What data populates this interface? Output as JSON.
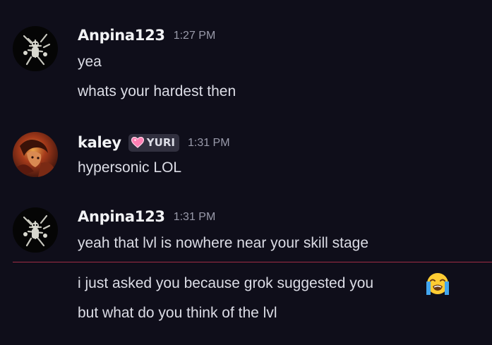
{
  "messages": [
    {
      "username": "Anpina123",
      "timestamp": "1:27 PM",
      "lines": [
        "yea",
        "whats your hardest then"
      ]
    },
    {
      "username": "kaley",
      "badge": "YURI",
      "timestamp": "1:31 PM",
      "lines": [
        "hypersonic LOL"
      ]
    },
    {
      "username": "Anpina123",
      "timestamp": "1:31 PM",
      "lines": [
        "yeah that lvl is nowhere near your skill stage"
      ]
    }
  ],
  "new_messages": [
    "i just asked you because grok suggested you",
    "but what do you think of the lvl"
  ],
  "icons": {
    "badge_icon": "pink-heart-icon",
    "emoji": "loudly-crying-face-emoji",
    "avatar_anpina": "skeleton-creature-avatar",
    "avatar_kaley": "anime-character-avatar"
  },
  "colors": {
    "background": "#0f0e1a",
    "username": "#f2f3f5",
    "message_text": "#dcdde6",
    "timestamp": "#9a9bab",
    "badge_bg": "#31303f",
    "new_message_divider": "#a12d45"
  }
}
